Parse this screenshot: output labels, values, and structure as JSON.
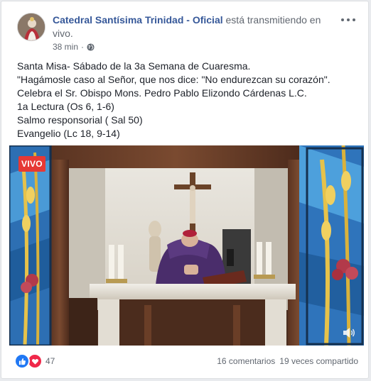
{
  "post": {
    "page_name": "Catedral Santísima Trinidad - Oficial",
    "action_text": " está transmitiendo en vivo.",
    "time": "38 min",
    "separator": "·",
    "privacy_icon": "globe-icon",
    "more_icon": "more-horizontal-icon",
    "body_lines": [
      "Santa Misa- Sábado de la 3a Semana de Cuaresma.",
      "\"Hagámosle caso al Señor, que nos dice: \"No endurezcan su corazón\".",
      "Celebra el Sr. Obispo Mons. Pedro Pablo Elizondo Cárdenas L.C.",
      "1a Lectura (Os 6, 1-6)",
      "Salmo responsorial ( Sal 50)",
      "Evangelio (Lc 18, 9-14)"
    ]
  },
  "video": {
    "live_badge": "VIVO",
    "volume_icon": "volume-icon",
    "scene": "bishop-at-altar"
  },
  "footer": {
    "reaction_icons": [
      "like-icon",
      "love-icon"
    ],
    "reaction_count": "47",
    "comments": "16 comentarios",
    "shares": "19 veces compartido"
  },
  "colors": {
    "link": "#365899",
    "live_red": "#e63935",
    "like_blue": "#2078f4",
    "love_red": "#f0284a"
  }
}
